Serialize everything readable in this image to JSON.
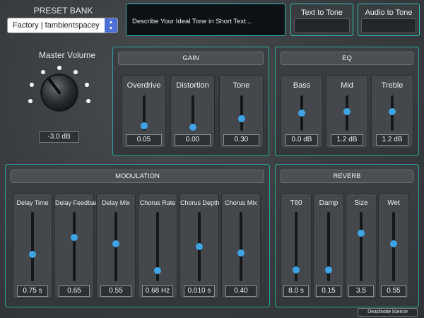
{
  "preset_bank": {
    "title": "PRESET BANK",
    "selected": "Factory | fambientspacey"
  },
  "description": {
    "text": "Describe Your Ideal Tone in Short Text..."
  },
  "modes": {
    "text_to_tone": "Text to Tone",
    "audio_to_tone": "Audio to Tone"
  },
  "master_volume": {
    "label": "Master Volume",
    "value": "-3.0 dB"
  },
  "gain": {
    "title": "GAIN",
    "controls": [
      {
        "label": "Overdrive",
        "value": "0.05",
        "level": 0.05
      },
      {
        "label": "Distortion",
        "value": "0.00",
        "level": 0.0
      },
      {
        "label": "Tone",
        "value": "0.30",
        "level": 0.3
      }
    ]
  },
  "eq": {
    "title": "EQ",
    "controls": [
      {
        "label": "Bass",
        "value": "0.0 dB",
        "level": 0.5
      },
      {
        "label": "Mid",
        "value": "1.2 dB",
        "level": 0.55
      },
      {
        "label": "Treble",
        "value": "1.2 dB",
        "level": 0.55
      }
    ]
  },
  "modulation": {
    "title": "MODULATION",
    "controls": [
      {
        "label": "Delay Time",
        "value": "0.75 s",
        "level": 0.37
      },
      {
        "label": "Delay Feedback",
        "value": "0.65",
        "level": 0.65
      },
      {
        "label": "Delay Mix",
        "value": "0.55",
        "level": 0.55
      },
      {
        "label": "Chorus Rate",
        "value": "0.68 Hz",
        "level": 0.11
      },
      {
        "label": "Chorus Depth",
        "value": "0.010 s",
        "level": 0.5
      },
      {
        "label": "Chorus Mix",
        "value": "0.40",
        "level": 0.4
      }
    ]
  },
  "reverb": {
    "title": "REVERB",
    "controls": [
      {
        "label": "T60",
        "value": "8.0 s",
        "level": 0.12
      },
      {
        "label": "Damp",
        "value": "0.15",
        "level": 0.12
      },
      {
        "label": "Size",
        "value": "3.5",
        "level": 0.72
      },
      {
        "label": "Wet",
        "value": "0.55",
        "level": 0.55
      }
    ]
  },
  "footer": {
    "deactivate": "Deactivate licence"
  },
  "colors": {
    "accent": "#2dbbb0",
    "thumb": "#3ea4e6",
    "select_arrow": "#4b6fd6"
  }
}
